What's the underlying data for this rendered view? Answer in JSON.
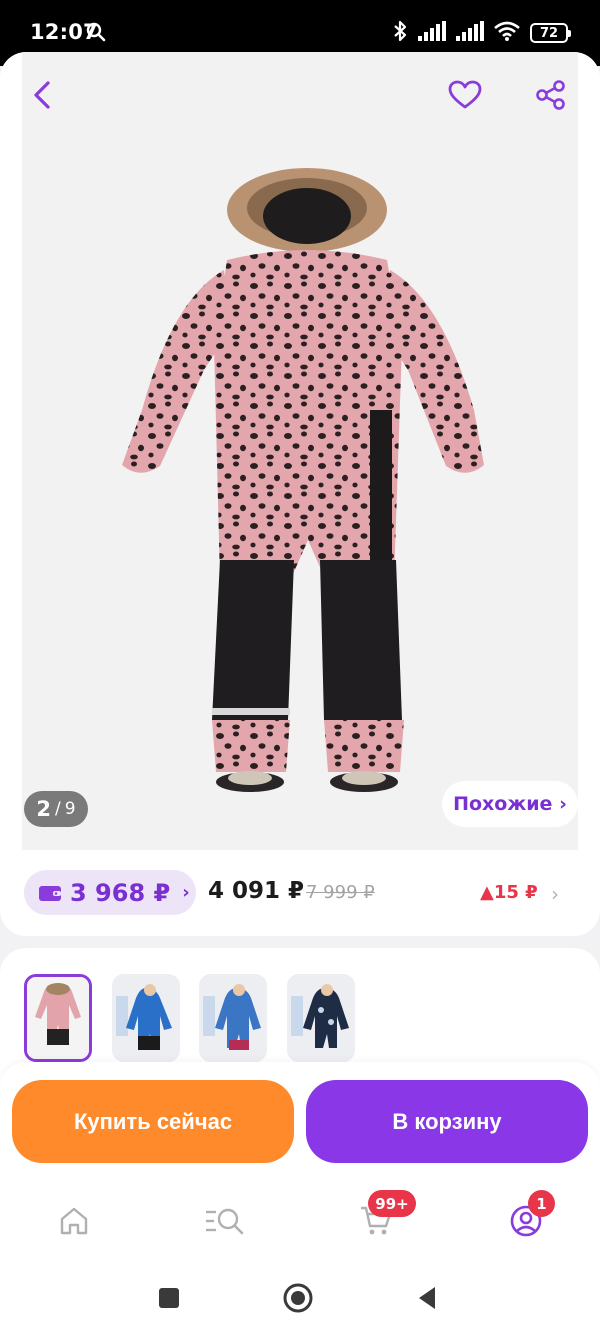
{
  "status_bar": {
    "time": "12:07",
    "battery": "72"
  },
  "product": {
    "image_counter": {
      "current": "2",
      "separator": "/",
      "total": "9"
    },
    "similar_label": "Похожие ›"
  },
  "pricing": {
    "wallet_price": "3 968 ₽",
    "wallet_chevron": "›",
    "regular_price": "4 091 ₽",
    "old_price": "7 999 ₽",
    "delta": "▲15 ₽",
    "chevron": "›"
  },
  "thumbnails": [
    {
      "label": "thumbnail-1",
      "active": true
    },
    {
      "label": "thumbnail-2",
      "active": false
    },
    {
      "label": "thumbnail-3",
      "active": false
    },
    {
      "label": "thumbnail-4",
      "active": false
    }
  ],
  "actions": {
    "buy_now": "Купить сейчас",
    "add_to_cart": "В корзину"
  },
  "tab_bar": {
    "cart_badge": "99+",
    "profile_badge": "1"
  },
  "colors": {
    "accent": "#8a37e8",
    "buy": "#ff8a2c",
    "badge": "#e8354a"
  }
}
